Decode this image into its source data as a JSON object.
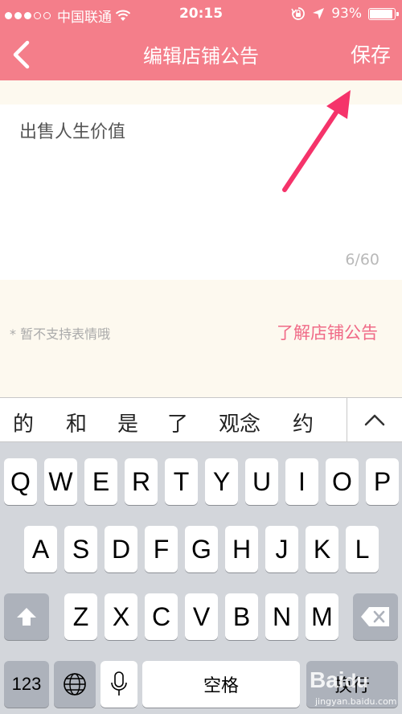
{
  "status_bar": {
    "signal_dots_filled": 3,
    "signal_dots_total": 5,
    "carrier": "中国联通",
    "time": "20:15",
    "battery": "93%",
    "icons": [
      "wifi-icon",
      "rotation-lock-icon",
      "location-arrow-icon",
      "battery-icon"
    ]
  },
  "nav": {
    "title": "编辑店铺公告",
    "save_label": "保存",
    "back_icon": "chevron-left-icon"
  },
  "editor": {
    "text": "出售人生价值",
    "char_count": "6/60"
  },
  "note": "* 暂不支持表情哦",
  "learn_link": "了解店铺公告",
  "candidates": [
    "的",
    "和",
    "是",
    "了",
    "观念",
    "约"
  ],
  "keyboard": {
    "row1": [
      "Q",
      "W",
      "E",
      "R",
      "T",
      "Y",
      "U",
      "I",
      "O",
      "P"
    ],
    "row2": [
      "A",
      "S",
      "D",
      "F",
      "G",
      "H",
      "J",
      "K",
      "L"
    ],
    "row3": [
      "Z",
      "X",
      "C",
      "V",
      "B",
      "N",
      "M"
    ],
    "numbers_label": "123",
    "space_label": "空格",
    "return_label": "换行"
  },
  "watermark": {
    "text": "Baiดู",
    "sub": "jingyan.baidu.com"
  },
  "colors": {
    "header": "#f47e8a",
    "link": "#f06a87",
    "arrow": "#f5336a",
    "background": "#fdf9ef"
  }
}
